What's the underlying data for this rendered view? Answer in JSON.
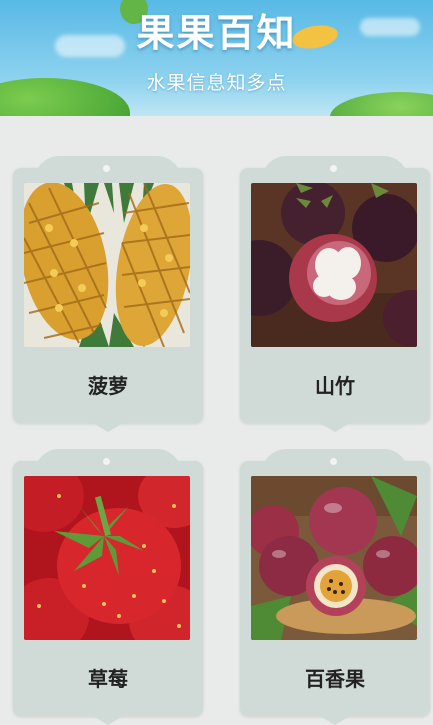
{
  "header": {
    "title": "果果百知",
    "subtitle": "水果信息知多点"
  },
  "fruits": [
    {
      "name": "菠萝",
      "icon": "pineapple-photo"
    },
    {
      "name": "山竹",
      "icon": "mangosteen-photo"
    },
    {
      "name": "草莓",
      "icon": "strawberry-photo"
    },
    {
      "name": "百香果",
      "icon": "passion-fruit-photo"
    }
  ],
  "colors": {
    "card": "#d0dbd8",
    "background": "#e9ebea",
    "header_sky": "#58b9e6"
  }
}
